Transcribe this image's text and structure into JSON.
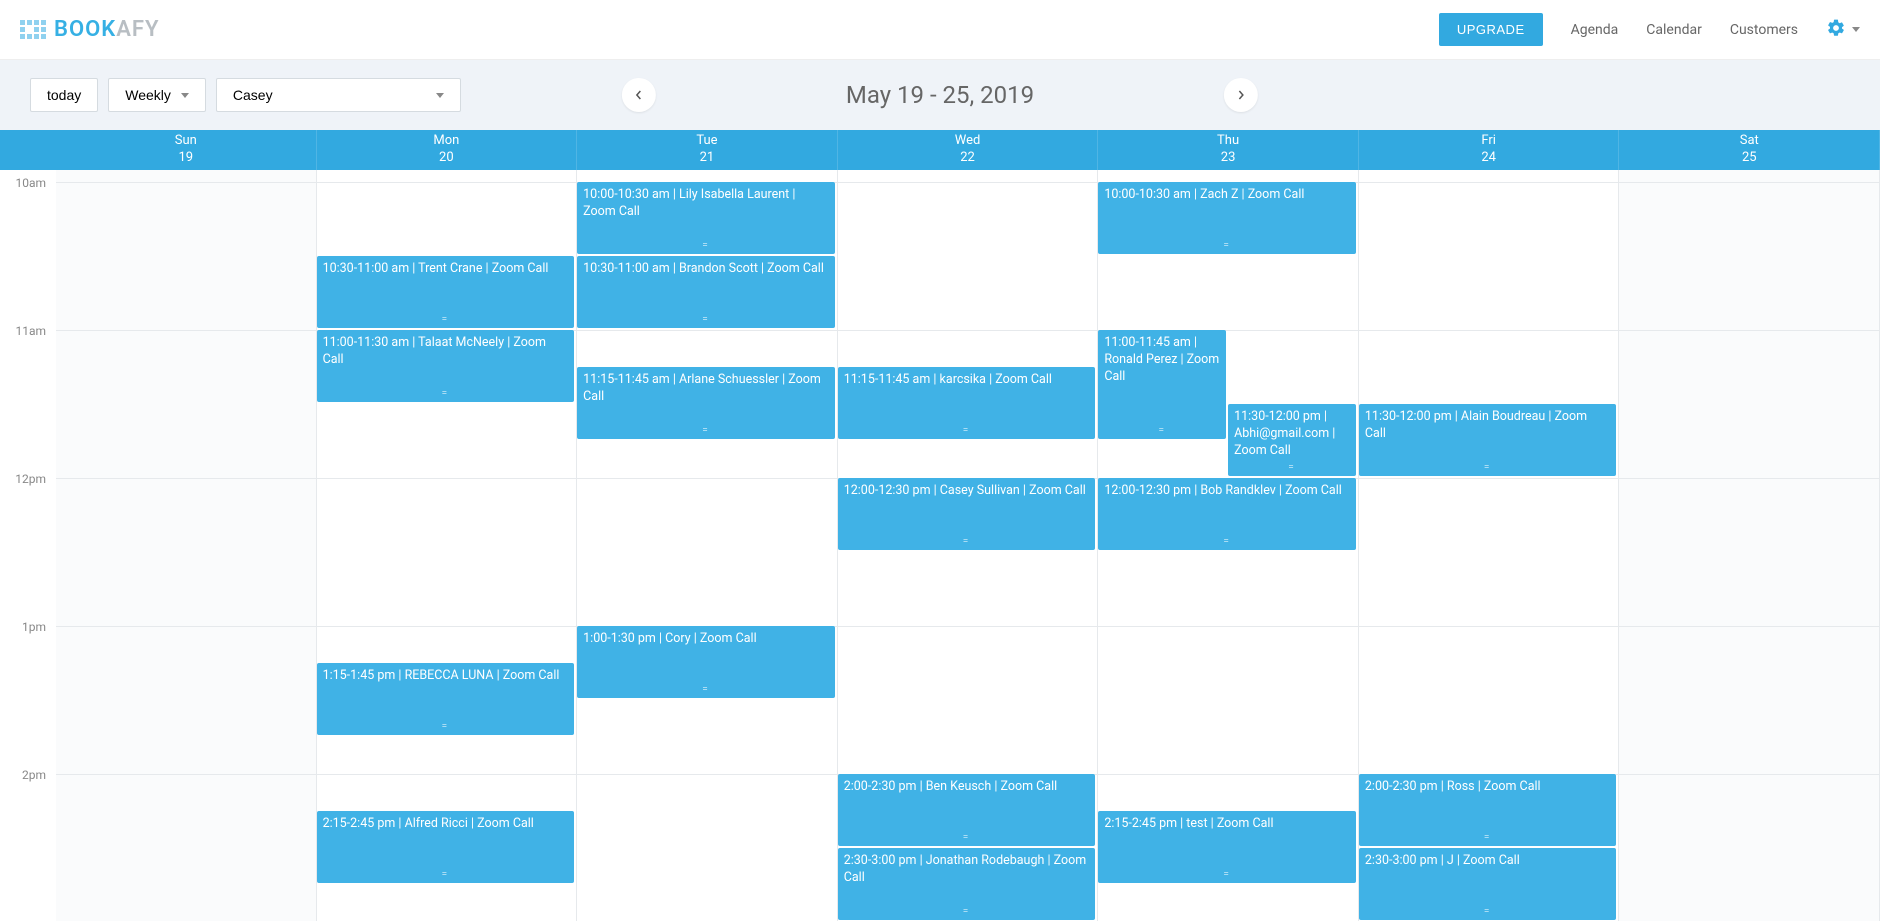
{
  "brand": {
    "name1": "BOOK",
    "name2": "AFY"
  },
  "header": {
    "upgrade": "UPGRADE",
    "nav": {
      "agenda": "Agenda",
      "calendar": "Calendar",
      "customers": "Customers"
    }
  },
  "toolbar": {
    "today": "today",
    "view": "Weekly",
    "user": "Casey",
    "date_range": "May 19 - 25, 2019"
  },
  "days": [
    {
      "name": "Sun",
      "num": "19"
    },
    {
      "name": "Mon",
      "num": "20"
    },
    {
      "name": "Tue",
      "num": "21"
    },
    {
      "name": "Wed",
      "num": "22"
    },
    {
      "name": "Thu",
      "num": "23"
    },
    {
      "name": "Fri",
      "num": "24"
    },
    {
      "name": "Sat",
      "num": "25"
    }
  ],
  "time_labels": [
    "10am",
    "11am",
    "12pm",
    "1pm",
    "2pm"
  ],
  "hour_height": 148,
  "events": [
    {
      "day": 1,
      "start_min": 30,
      "dur": 30,
      "w": 1,
      "off": 0,
      "text": "10:30-11:00 am | Trent Crane | Zoom Call"
    },
    {
      "day": 1,
      "start_min": 60,
      "dur": 30,
      "w": 1,
      "off": 0,
      "text": "11:00-11:30 am | Talaat McNeely | Zoom Call"
    },
    {
      "day": 1,
      "start_min": 195,
      "dur": 30,
      "w": 1,
      "off": 0,
      "text": "1:15-1:45 pm | REBECCA LUNA | Zoom Call"
    },
    {
      "day": 1,
      "start_min": 255,
      "dur": 30,
      "w": 1,
      "off": 0,
      "text": "2:15-2:45 pm | Alfred Ricci | Zoom Call"
    },
    {
      "day": 2,
      "start_min": 0,
      "dur": 30,
      "w": 1,
      "off": 0,
      "text": "10:00-10:30 am | Lily Isabella Laurent | Zoom Call"
    },
    {
      "day": 2,
      "start_min": 30,
      "dur": 30,
      "w": 1,
      "off": 0,
      "text": "10:30-11:00 am | Brandon Scott | Zoom Call"
    },
    {
      "day": 2,
      "start_min": 75,
      "dur": 30,
      "w": 1,
      "off": 0,
      "text": "11:15-11:45 am | Arlane Schuessler | Zoom Call"
    },
    {
      "day": 2,
      "start_min": 180,
      "dur": 30,
      "w": 1,
      "off": 0,
      "text": "1:00-1:30 pm | Cory | Zoom Call"
    },
    {
      "day": 3,
      "start_min": 75,
      "dur": 30,
      "w": 1,
      "off": 0,
      "text": "11:15-11:45 am | karcsika | Zoom Call"
    },
    {
      "day": 3,
      "start_min": 120,
      "dur": 30,
      "w": 1,
      "off": 0,
      "text": "12:00-12:30 pm | Casey Sullivan | Zoom Call"
    },
    {
      "day": 3,
      "start_min": 240,
      "dur": 30,
      "w": 1,
      "off": 0,
      "text": "2:00-2:30 pm | Ben Keusch | Zoom Call"
    },
    {
      "day": 3,
      "start_min": 270,
      "dur": 30,
      "w": 1,
      "off": 0,
      "text": "2:30-3:00 pm | Jonathan Rodebaugh | Zoom Call"
    },
    {
      "day": 4,
      "start_min": 0,
      "dur": 30,
      "w": 1,
      "off": 0,
      "text": "10:00-10:30 am | Zach Z | Zoom Call"
    },
    {
      "day": 4,
      "start_min": 60,
      "dur": 45,
      "w": 0.5,
      "off": 0,
      "text": "11:00-11:45 am | Ronald Perez | Zoom Call"
    },
    {
      "day": 4,
      "start_min": 90,
      "dur": 30,
      "w": 0.5,
      "off": 0.5,
      "text": "11:30-12:00 pm | Abhi@gmail.com | Zoom Call"
    },
    {
      "day": 4,
      "start_min": 120,
      "dur": 30,
      "w": 1,
      "off": 0,
      "text": "12:00-12:30 pm | Bob Randklev | Zoom Call"
    },
    {
      "day": 4,
      "start_min": 255,
      "dur": 30,
      "w": 1,
      "off": 0,
      "text": "2:15-2:45 pm | test | Zoom Call"
    },
    {
      "day": 5,
      "start_min": 90,
      "dur": 30,
      "w": 1,
      "off": 0,
      "text": "11:30-12:00 pm | Alain Boudreau | Zoom Call"
    },
    {
      "day": 5,
      "start_min": 240,
      "dur": 30,
      "w": 1,
      "off": 0,
      "text": "2:00-2:30 pm | Ross | Zoom Call"
    },
    {
      "day": 5,
      "start_min": 270,
      "dur": 30,
      "w": 1,
      "off": 0,
      "text": "2:30-3:00 pm | J | Zoom Call"
    }
  ]
}
